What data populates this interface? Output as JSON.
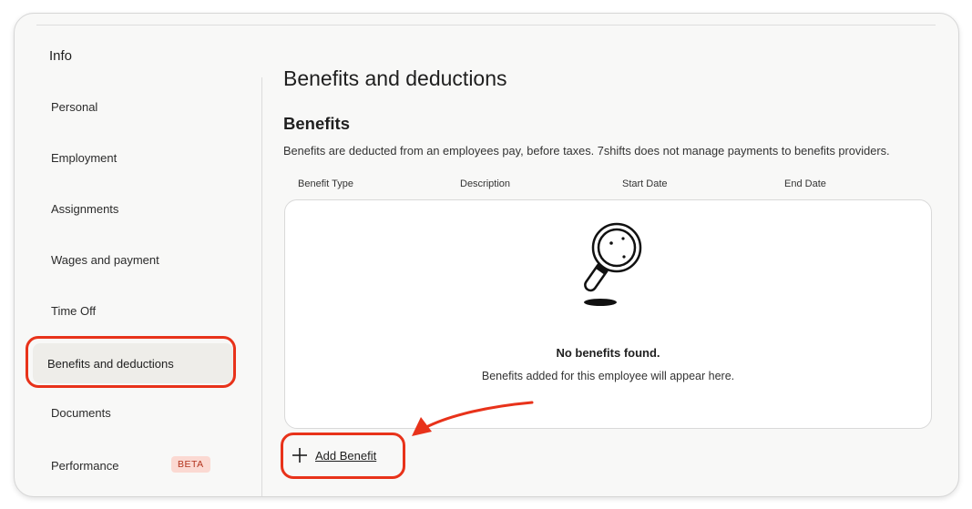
{
  "sidebar": {
    "title": "Info",
    "items": [
      {
        "label": "Personal"
      },
      {
        "label": "Employment"
      },
      {
        "label": "Assignments"
      },
      {
        "label": "Wages and payment"
      },
      {
        "label": "Time Off"
      },
      {
        "label": "Benefits and deductions"
      },
      {
        "label": "Documents"
      },
      {
        "label": "Performance",
        "badge": "BETA"
      }
    ],
    "active_index": 5
  },
  "main": {
    "title": "Benefits and deductions",
    "section_title": "Benefits",
    "section_description": "Benefits are deducted from an employees pay, before taxes. 7shifts does not manage payments to benefits providers.",
    "columns": [
      "Benefit Type",
      "Description",
      "Start Date",
      "End Date"
    ],
    "empty_state": {
      "icon": "magnifying-glass-icon",
      "title": "No benefits found.",
      "subtitle": "Benefits added for this employee will appear here."
    },
    "add_button": {
      "icon": "plus-icon",
      "label": "Add Benefit"
    }
  },
  "annotations": {
    "highlight_color": "#e8321a"
  }
}
